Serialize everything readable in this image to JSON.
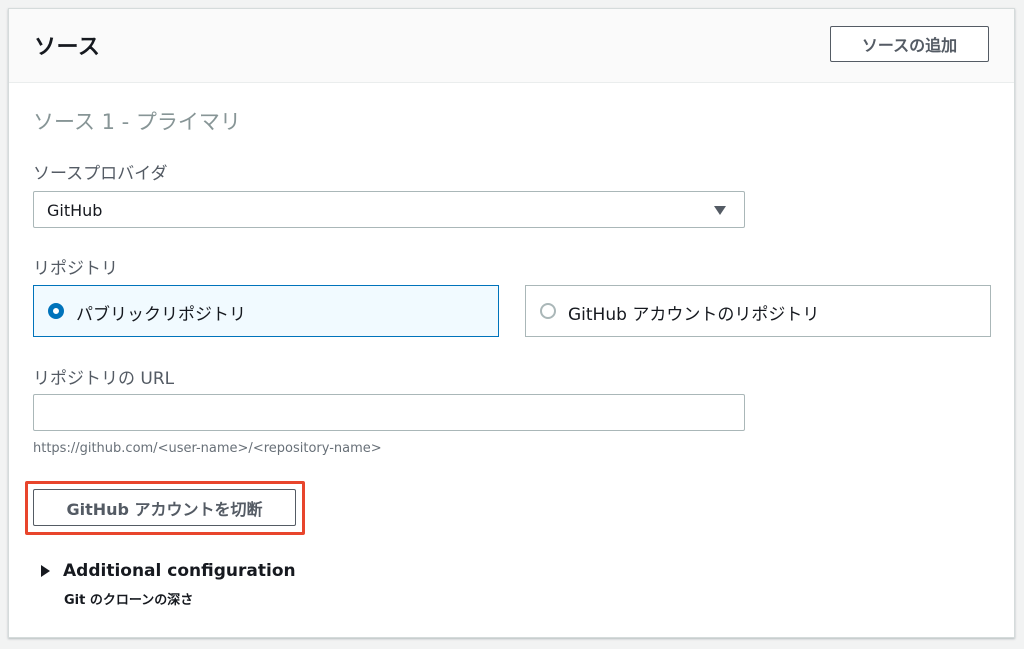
{
  "header": {
    "title": "ソース",
    "add_source_label": "ソースの追加"
  },
  "section": {
    "title": "ソース 1 - プライマリ"
  },
  "source_provider": {
    "label": "ソースプロバイダ",
    "selected": "GitHub"
  },
  "repository": {
    "label": "リポジトリ",
    "options": [
      {
        "label": "パブリックリポジトリ",
        "selected": true
      },
      {
        "label": "GitHub アカウントのリポジトリ",
        "selected": false
      }
    ]
  },
  "repo_url": {
    "label": "リポジトリの URL",
    "value": "",
    "hint": "https://github.com/<user-name>/<repository-name>"
  },
  "disconnect": {
    "label": "GitHub アカウントを切断",
    "highlight_color": "#e8452c"
  },
  "additional": {
    "label": "Additional configuration",
    "description": "Git のクローンの深さ"
  },
  "colors": {
    "accent": "#0073bb",
    "selected_tile_bg": "#f1faff"
  }
}
